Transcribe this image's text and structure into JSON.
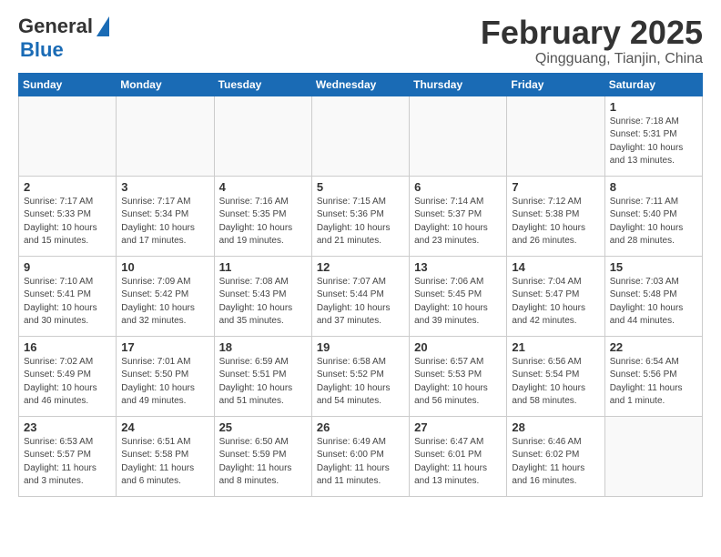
{
  "logo": {
    "text_general": "General",
    "text_blue": "Blue"
  },
  "header": {
    "month_year": "February 2025",
    "location": "Qingguang, Tianjin, China"
  },
  "weekdays": [
    "Sunday",
    "Monday",
    "Tuesday",
    "Wednesday",
    "Thursday",
    "Friday",
    "Saturday"
  ],
  "weeks": [
    [
      {
        "day": "",
        "info": ""
      },
      {
        "day": "",
        "info": ""
      },
      {
        "day": "",
        "info": ""
      },
      {
        "day": "",
        "info": ""
      },
      {
        "day": "",
        "info": ""
      },
      {
        "day": "",
        "info": ""
      },
      {
        "day": "1",
        "info": "Sunrise: 7:18 AM\nSunset: 5:31 PM\nDaylight: 10 hours\nand 13 minutes."
      }
    ],
    [
      {
        "day": "2",
        "info": "Sunrise: 7:17 AM\nSunset: 5:33 PM\nDaylight: 10 hours\nand 15 minutes."
      },
      {
        "day": "3",
        "info": "Sunrise: 7:17 AM\nSunset: 5:34 PM\nDaylight: 10 hours\nand 17 minutes."
      },
      {
        "day": "4",
        "info": "Sunrise: 7:16 AM\nSunset: 5:35 PM\nDaylight: 10 hours\nand 19 minutes."
      },
      {
        "day": "5",
        "info": "Sunrise: 7:15 AM\nSunset: 5:36 PM\nDaylight: 10 hours\nand 21 minutes."
      },
      {
        "day": "6",
        "info": "Sunrise: 7:14 AM\nSunset: 5:37 PM\nDaylight: 10 hours\nand 23 minutes."
      },
      {
        "day": "7",
        "info": "Sunrise: 7:12 AM\nSunset: 5:38 PM\nDaylight: 10 hours\nand 26 minutes."
      },
      {
        "day": "8",
        "info": "Sunrise: 7:11 AM\nSunset: 5:40 PM\nDaylight: 10 hours\nand 28 minutes."
      }
    ],
    [
      {
        "day": "9",
        "info": "Sunrise: 7:10 AM\nSunset: 5:41 PM\nDaylight: 10 hours\nand 30 minutes."
      },
      {
        "day": "10",
        "info": "Sunrise: 7:09 AM\nSunset: 5:42 PM\nDaylight: 10 hours\nand 32 minutes."
      },
      {
        "day": "11",
        "info": "Sunrise: 7:08 AM\nSunset: 5:43 PM\nDaylight: 10 hours\nand 35 minutes."
      },
      {
        "day": "12",
        "info": "Sunrise: 7:07 AM\nSunset: 5:44 PM\nDaylight: 10 hours\nand 37 minutes."
      },
      {
        "day": "13",
        "info": "Sunrise: 7:06 AM\nSunset: 5:45 PM\nDaylight: 10 hours\nand 39 minutes."
      },
      {
        "day": "14",
        "info": "Sunrise: 7:04 AM\nSunset: 5:47 PM\nDaylight: 10 hours\nand 42 minutes."
      },
      {
        "day": "15",
        "info": "Sunrise: 7:03 AM\nSunset: 5:48 PM\nDaylight: 10 hours\nand 44 minutes."
      }
    ],
    [
      {
        "day": "16",
        "info": "Sunrise: 7:02 AM\nSunset: 5:49 PM\nDaylight: 10 hours\nand 46 minutes."
      },
      {
        "day": "17",
        "info": "Sunrise: 7:01 AM\nSunset: 5:50 PM\nDaylight: 10 hours\nand 49 minutes."
      },
      {
        "day": "18",
        "info": "Sunrise: 6:59 AM\nSunset: 5:51 PM\nDaylight: 10 hours\nand 51 minutes."
      },
      {
        "day": "19",
        "info": "Sunrise: 6:58 AM\nSunset: 5:52 PM\nDaylight: 10 hours\nand 54 minutes."
      },
      {
        "day": "20",
        "info": "Sunrise: 6:57 AM\nSunset: 5:53 PM\nDaylight: 10 hours\nand 56 minutes."
      },
      {
        "day": "21",
        "info": "Sunrise: 6:56 AM\nSunset: 5:54 PM\nDaylight: 10 hours\nand 58 minutes."
      },
      {
        "day": "22",
        "info": "Sunrise: 6:54 AM\nSunset: 5:56 PM\nDaylight: 11 hours\nand 1 minute."
      }
    ],
    [
      {
        "day": "23",
        "info": "Sunrise: 6:53 AM\nSunset: 5:57 PM\nDaylight: 11 hours\nand 3 minutes."
      },
      {
        "day": "24",
        "info": "Sunrise: 6:51 AM\nSunset: 5:58 PM\nDaylight: 11 hours\nand 6 minutes."
      },
      {
        "day": "25",
        "info": "Sunrise: 6:50 AM\nSunset: 5:59 PM\nDaylight: 11 hours\nand 8 minutes."
      },
      {
        "day": "26",
        "info": "Sunrise: 6:49 AM\nSunset: 6:00 PM\nDaylight: 11 hours\nand 11 minutes."
      },
      {
        "day": "27",
        "info": "Sunrise: 6:47 AM\nSunset: 6:01 PM\nDaylight: 11 hours\nand 13 minutes."
      },
      {
        "day": "28",
        "info": "Sunrise: 6:46 AM\nSunset: 6:02 PM\nDaylight: 11 hours\nand 16 minutes."
      },
      {
        "day": "",
        "info": ""
      }
    ]
  ]
}
